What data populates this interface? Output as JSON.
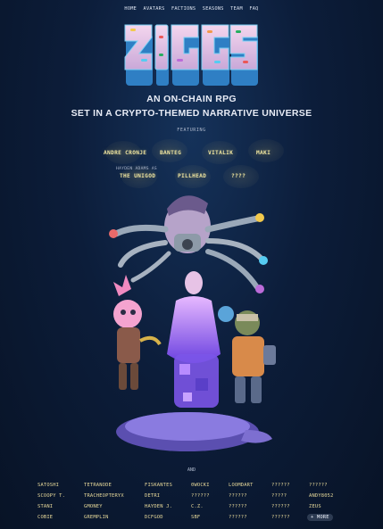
{
  "nav": [
    "HOME",
    "AVATARS",
    "FACTIONS",
    "SEASONS",
    "TEAM",
    "FAQ"
  ],
  "logo": {
    "text": "ZIGGS"
  },
  "subtitle": {
    "line1": "AN ON-CHAIN RPG",
    "line2": "SET IN A CRYPTO-THEMED NARRATIVE UNIVERSE"
  },
  "featuring": {
    "label": "FEATURING",
    "names": [
      "ANDRE CRONJE",
      "BANTEG",
      "VITALIK",
      "MAKI"
    ],
    "hayden_label": "HAYDEN ADAMS AS",
    "row2": [
      "THE UNIGOD",
      "PILLHEAD",
      "????"
    ]
  },
  "and_label": "AND",
  "more_label": "+ MORE",
  "roster": [
    [
      "SATOSHI",
      "TETRANODE",
      "FISKANTES",
      "0WOCKI",
      "LOOMDART",
      "??????",
      "??????"
    ],
    [
      "SCOOPY T.",
      "TRACHEOPTERYX",
      "DETRI",
      "??????",
      "??????",
      "?????",
      "ANDY8052"
    ],
    [
      "STANI",
      "GMONEY",
      "HAYDEN J.",
      "C.Z.",
      "??????",
      "??????",
      "ZEUS"
    ],
    [
      "COBIE",
      "GREMPLIN",
      "DCFGOD",
      "SBF",
      "??????",
      "??????",
      ""
    ]
  ],
  "colors": {
    "background": "#0c1d3a",
    "accent_name": "#f0e6a0",
    "text": "#e8ecf6"
  }
}
